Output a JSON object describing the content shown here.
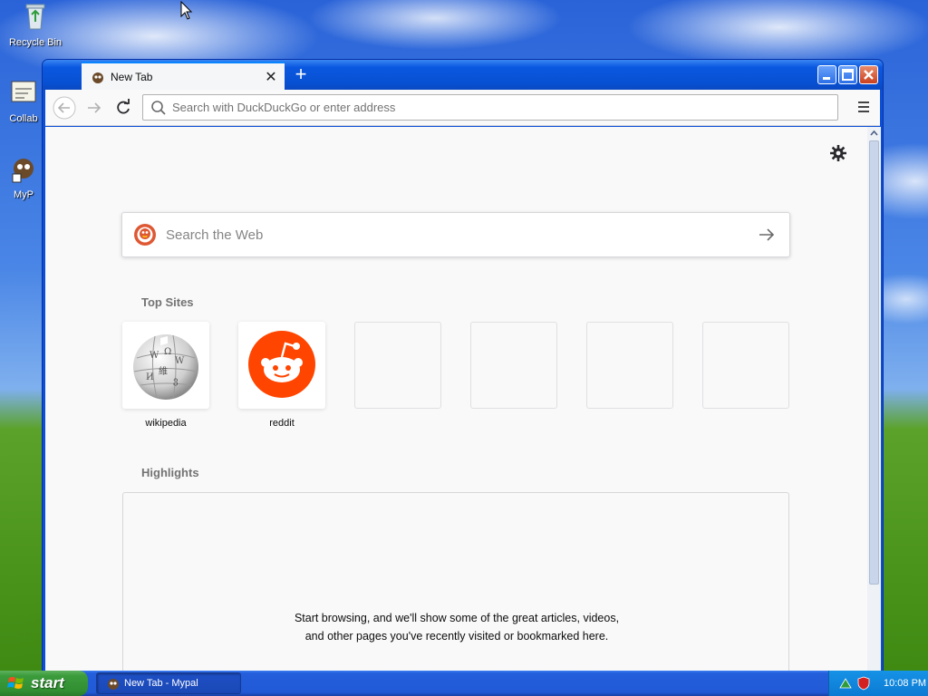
{
  "desktop": {
    "icons": [
      {
        "label": "Recycle Bin"
      },
      {
        "label": "Collab"
      },
      {
        "label": "MyP"
      }
    ]
  },
  "browser": {
    "tab_title": "New Tab",
    "address_placeholder": "Search with DuckDuckGo or enter address",
    "web_search_placeholder": "Search the Web",
    "top_sites_title": "Top Sites",
    "top_sites": [
      {
        "label": "wikipedia",
        "icon": "wikipedia-globe-icon"
      },
      {
        "label": "reddit",
        "icon": "reddit-alien-icon"
      },
      {
        "label": ""
      },
      {
        "label": ""
      },
      {
        "label": ""
      },
      {
        "label": ""
      }
    ],
    "highlights_title": "Highlights",
    "highlights_message": "Start browsing, and we'll show some of the great articles, videos, and other pages you've recently visited or bookmarked here."
  },
  "taskbar": {
    "start_label": "start",
    "task_label": "New Tab - Mypal",
    "clock": "10:08 PM"
  },
  "colors": {
    "titlebar": "#0a58e0",
    "reddit": "#ff4500",
    "duckduckgo": "#de5833",
    "start_green": "#3c9c3c"
  }
}
